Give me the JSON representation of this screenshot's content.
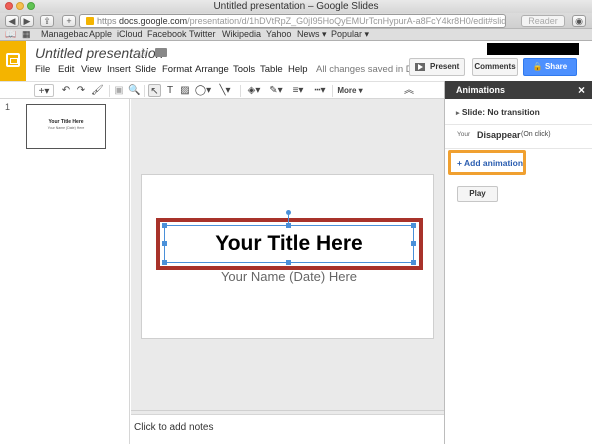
{
  "browser": {
    "window_title": "Untitled presentation – Google Slides",
    "url_scheme": "https",
    "url_host": "docs.google.com",
    "url_path": "/presentation/d/1hDVtRpZ_G0jI95HoQyEMUrTcnHypurA-a8FcY4kr8H0/edit#slide=id.p",
    "reader_label": "Reader",
    "bookmarks": [
      "Managebac",
      "Apple",
      "iCloud",
      "Facebook",
      "Twitter",
      "Wikipedia",
      "Yahoo",
      "News ▾",
      "Popular ▾"
    ]
  },
  "app": {
    "doc_title": "Untitled presentation",
    "menu": [
      "File",
      "Edit",
      "View",
      "Insert",
      "Slide",
      "Format",
      "Arrange",
      "Tools",
      "Table",
      "Help"
    ],
    "save_status": "All changes saved in Dr...",
    "present_label": "Present",
    "comments_label": "Comments",
    "share_label": "Share",
    "more_label": "More",
    "brand_color": "#f4b400",
    "share_color": "#4d90fe"
  },
  "filmstrip": {
    "slides": [
      {
        "number": "1",
        "title": "Your Title Here",
        "subtitle": "Your Name (Date) Here"
      }
    ]
  },
  "slide": {
    "title": "Your Title Here",
    "subtitle": "Your Name (Date) Here"
  },
  "notes": {
    "placeholder": "Click to add notes"
  },
  "animations": {
    "title": "Animations",
    "close": "×",
    "transition": "Slide: No transition",
    "item": {
      "object": "Your",
      "effect": "Disappear",
      "trigger": "(On click)"
    },
    "add_label": "+ Add animation",
    "play_label": "Play",
    "highlight_color": "#f0a030"
  },
  "annotation_colors": {
    "title_highlight": "#a8322a"
  }
}
